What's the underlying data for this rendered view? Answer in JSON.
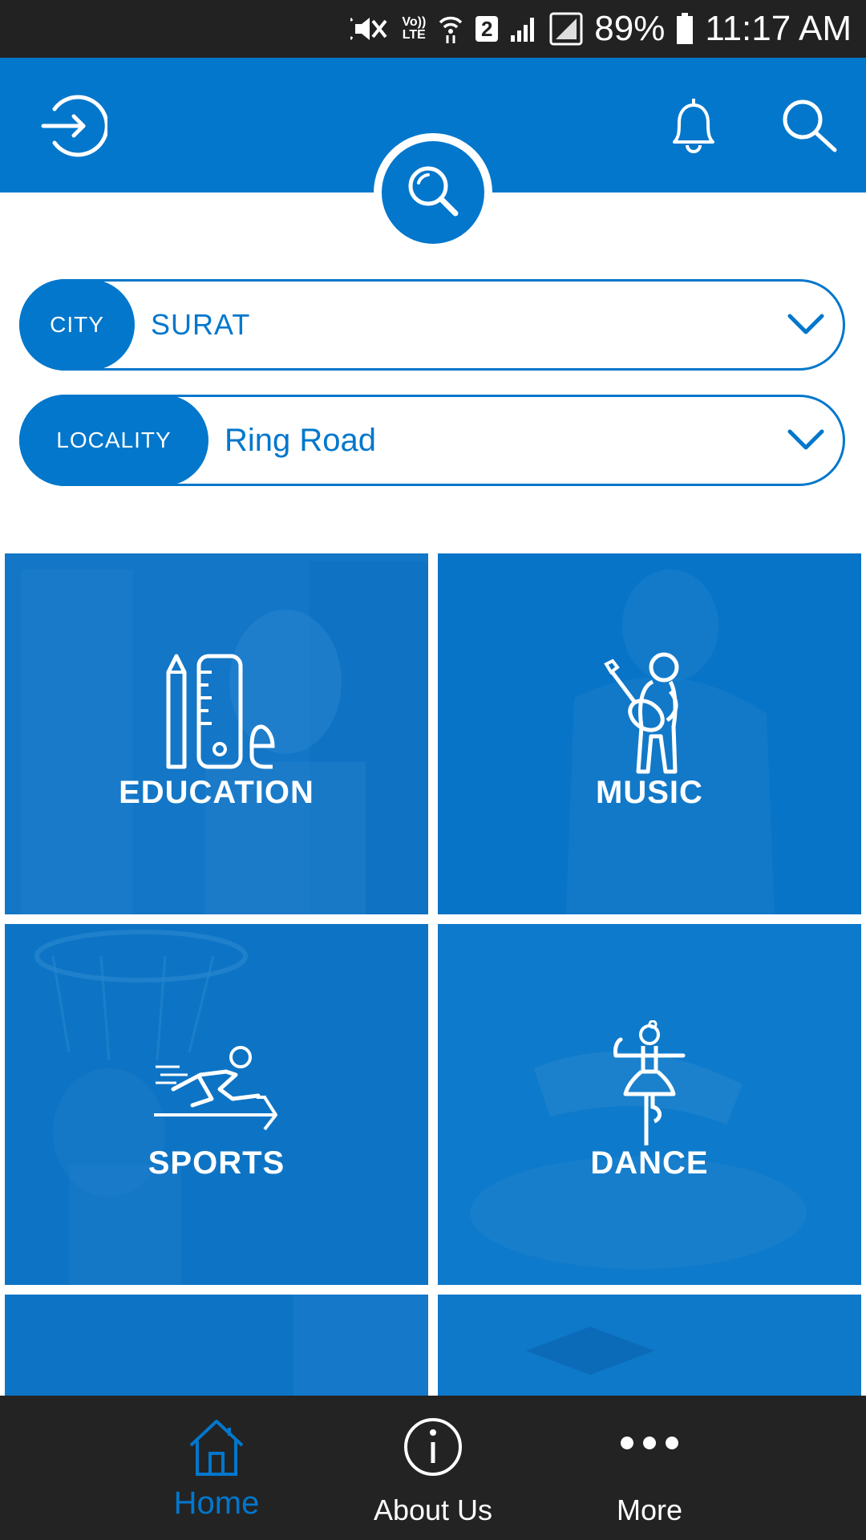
{
  "status_bar": {
    "battery": "89%",
    "time": "11:17 AM",
    "lte_top": "Vo))",
    "lte_bottom": "LTE",
    "sim": "2"
  },
  "header": {
    "icons": [
      "login-icon",
      "bell-icon",
      "search-icon"
    ],
    "logo_icon": "search-logo-icon",
    "color": "#0277cc"
  },
  "filters": {
    "city": {
      "label": "CITY",
      "value": "SURAT"
    },
    "locality": {
      "label": "LOCALITY",
      "value": "Ring Road"
    }
  },
  "categories": [
    {
      "label": "EDUCATION",
      "icon": "pencil-ruler-eraser-icon"
    },
    {
      "label": "MUSIC",
      "icon": "guitarist-icon"
    },
    {
      "label": "SPORTS",
      "icon": "sprinter-icon"
    },
    {
      "label": "DANCE",
      "icon": "ballerina-icon"
    }
  ],
  "bottom_nav": {
    "items": [
      {
        "label": "Home",
        "icon": "home-icon",
        "active": true
      },
      {
        "label": "About Us",
        "icon": "info-icon",
        "active": false
      },
      {
        "label": "More",
        "icon": "more-dots-icon",
        "active": false
      }
    ],
    "active_color": "#0277cc"
  }
}
